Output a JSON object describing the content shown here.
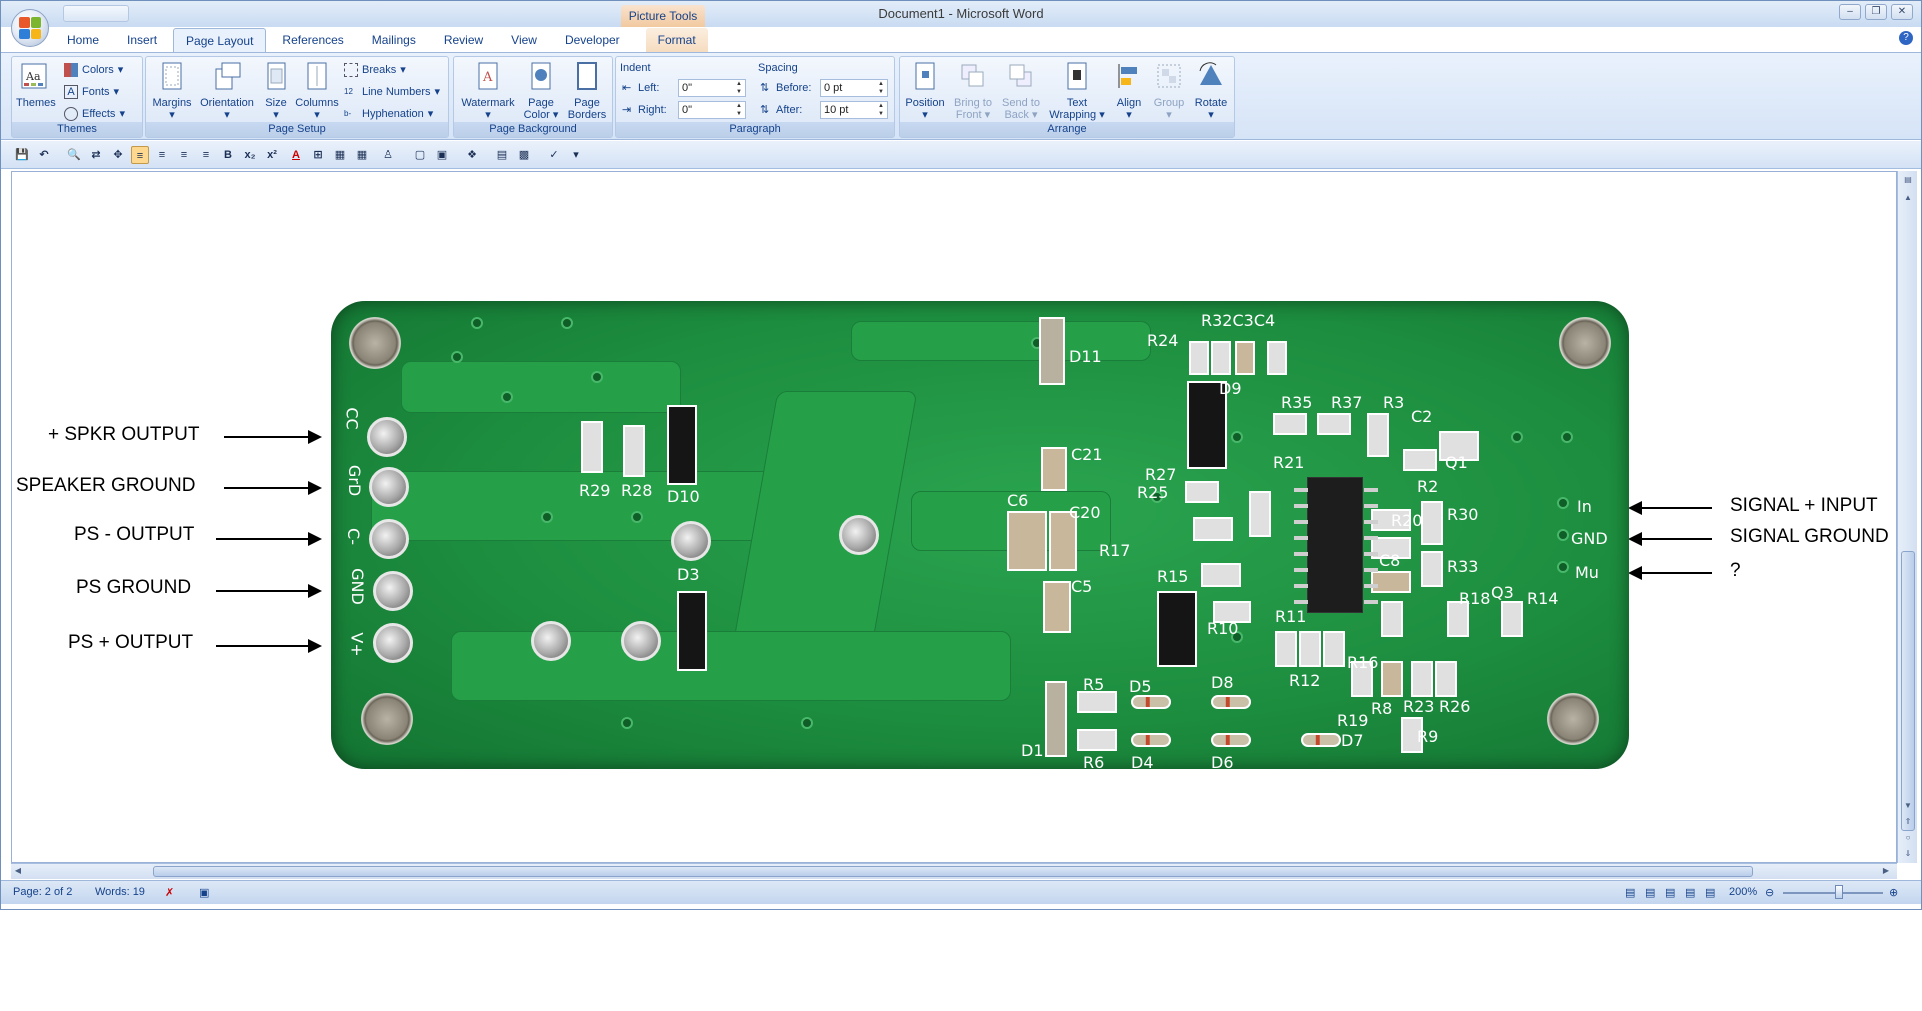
{
  "window": {
    "title": "Document1 - Microsoft Word",
    "context_tab_group": "Picture Tools",
    "controls": [
      "minimize",
      "restore",
      "close"
    ]
  },
  "tabs": [
    {
      "label": "Home"
    },
    {
      "label": "Insert"
    },
    {
      "label": "Page Layout",
      "active": true
    },
    {
      "label": "References"
    },
    {
      "label": "Mailings"
    },
    {
      "label": "Review"
    },
    {
      "label": "View"
    },
    {
      "label": "Developer"
    },
    {
      "label": "Format",
      "contextual": true
    }
  ],
  "ribbon": {
    "themes": {
      "label": "Themes",
      "themes_btn": "Themes",
      "colors": "Colors",
      "fonts": "Fonts",
      "effects": "Effects"
    },
    "page_setup": {
      "label": "Page Setup",
      "margins": "Margins",
      "orientation": "Orientation",
      "size": "Size",
      "columns": "Columns",
      "breaks": "Breaks",
      "line_numbers": "Line Numbers",
      "hyphenation": "Hyphenation"
    },
    "page_background": {
      "label": "Page Background",
      "watermark": "Watermark",
      "page_color_1": "Page",
      "page_color_2": "Color",
      "page_borders_1": "Page",
      "page_borders_2": "Borders"
    },
    "paragraph": {
      "label": "Paragraph",
      "indent_title": "Indent",
      "spacing_title": "Spacing",
      "left_label": "Left:",
      "right_label": "Right:",
      "before_label": "Before:",
      "after_label": "After:",
      "left_value": "0\"",
      "right_value": "0\"",
      "before_value": "0 pt",
      "after_value": "10 pt"
    },
    "arrange": {
      "label": "Arrange",
      "position": "Position",
      "bring_to_front_1": "Bring to",
      "bring_to_front_2": "Front",
      "send_to_back_1": "Send to",
      "send_to_back_2": "Back",
      "text_wrapping_1": "Text",
      "text_wrapping_2": "Wrapping",
      "align": "Align",
      "group": "Group",
      "rotate": "Rotate"
    }
  },
  "toolbar2": {
    "bold": "B",
    "subscript": "x₂",
    "superscript": "x²",
    "font_color": "A"
  },
  "document": {
    "left_labels": {
      "spkr_output": "+ SPKR OUTPUT",
      "speaker_ground": "SPEAKER GROUND",
      "ps_minus": "PS - OUTPUT",
      "ps_ground": "PS GROUND",
      "ps_plus": "PS + OUTPUT"
    },
    "right_labels": {
      "signal_input": "SIGNAL  + INPUT",
      "signal_ground": "SIGNAL GROUND",
      "unknown": "?"
    },
    "silkscreen": {
      "r32": "R32C3C4",
      "r24": "R24",
      "d11": "D11",
      "d9": "D9",
      "r35": "R35",
      "r37": "R37",
      "r3": "R3",
      "c2": "C2",
      "q1": "Q1",
      "c21": "C21",
      "r27": "R27",
      "r25": "R25",
      "r21": "R21",
      "r29": "R29",
      "r28": "R28",
      "d10": "D10",
      "c6": "C6",
      "c20": "C20",
      "r17": "R17",
      "r2": "R2",
      "r30": "R30",
      "r20": "R20",
      "in": "In",
      "gnd": "GND",
      "mu": "Mu",
      "d3": "D3",
      "c5": "C5",
      "r15": "R15",
      "c8": "C8",
      "r33": "R33",
      "r10": "R10",
      "r11": "R11",
      "r12": "R12",
      "r16": "R16",
      "r18": "R18",
      "q3": "Q3",
      "r14": "R14",
      "r5": "R5",
      "d5": "D5",
      "d8": "D8",
      "r6": "R6",
      "d4": "D4",
      "d6": "D6",
      "d7": "D7",
      "r19": "R19",
      "r8": "R8",
      "r23": "R23",
      "r26": "R26",
      "r9": "R9",
      "d1": "D1",
      "ccc": "CC",
      "gnd_left": "GrD",
      "minus": "C-",
      "gnd2": "GND",
      "plus": "V+"
    }
  },
  "status": {
    "page": "Page: 2 of 2",
    "words": "Words: 19",
    "zoom": "200%"
  }
}
